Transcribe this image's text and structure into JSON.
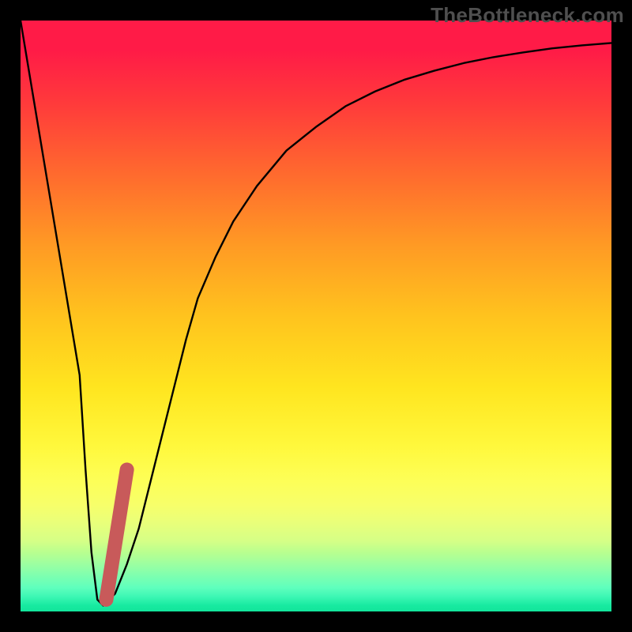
{
  "watermark": "TheBottleneck.com",
  "colors": {
    "frame": "#000000",
    "curve": "#000000",
    "marker_fill": "#c85a5a",
    "marker_stroke": "#b94d4d"
  },
  "chart_data": {
    "type": "line",
    "title": "",
    "xlabel": "",
    "ylabel": "",
    "xlim": [
      0,
      100
    ],
    "ylim": [
      0,
      100
    ],
    "note": "Values estimated from pixel positions; y is height above bottom (0=bottom, 100=top). Background hue maps y to bottleneck severity (green=low, red=high).",
    "series": [
      {
        "name": "bottleneck-curve",
        "x": [
          0,
          2,
          4,
          6,
          8,
          10,
          11,
          12,
          13,
          14,
          16,
          18,
          20,
          22,
          24,
          26,
          28,
          30,
          33,
          36,
          40,
          45,
          50,
          55,
          60,
          65,
          70,
          75,
          80,
          85,
          90,
          95,
          100
        ],
        "y": [
          100,
          88,
          76,
          64,
          52,
          40,
          24,
          10,
          2,
          1,
          3,
          8,
          14,
          22,
          30,
          38,
          46,
          53,
          60,
          66,
          72,
          78,
          82,
          85.5,
          88,
          90,
          91.5,
          92.8,
          93.8,
          94.6,
          95.3,
          95.8,
          96.2
        ]
      }
    ],
    "marker": {
      "name": "highlight-segment",
      "shape": "thick-line",
      "points": [
        {
          "x": 14.5,
          "y": 2.0
        },
        {
          "x": 18.0,
          "y": 24.0
        }
      ]
    }
  }
}
